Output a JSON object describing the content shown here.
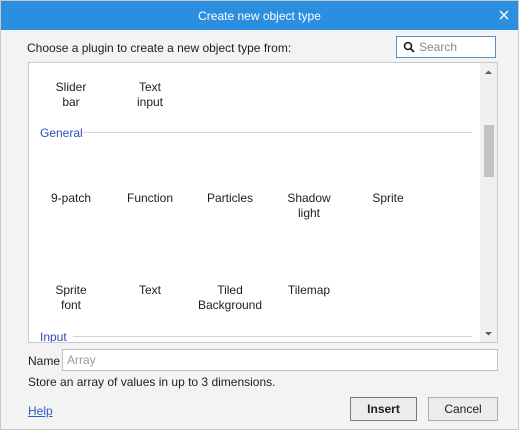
{
  "dialog": {
    "title": "Create new object type",
    "prompt": "Choose a plugin to create a new object type from:",
    "search": {
      "placeholder": "Search"
    }
  },
  "plugins": {
    "top_items": [
      {
        "line1": "Slider",
        "line2": "bar"
      },
      {
        "line1": "Text",
        "line2": "input"
      }
    ],
    "categories": {
      "general": "General",
      "input": "Input"
    },
    "general_row1": [
      {
        "line1": "9-patch",
        "line2": ""
      },
      {
        "line1": "Function",
        "line2": ""
      },
      {
        "line1": "Particles",
        "line2": ""
      },
      {
        "line1": "Shadow",
        "line2": "light"
      },
      {
        "line1": "Sprite",
        "line2": ""
      }
    ],
    "general_row2": [
      {
        "line1": "Sprite",
        "line2": "font"
      },
      {
        "line1": "Text",
        "line2": ""
      },
      {
        "line1": "Tiled",
        "line2": "Background"
      },
      {
        "line1": "Tilemap",
        "line2": ""
      }
    ]
  },
  "form": {
    "name_label": "Name",
    "name_placeholder": "Array",
    "description": "Store an array of values in up to 3 dimensions."
  },
  "footer": {
    "help": "Help",
    "insert": "Insert",
    "cancel": "Cancel"
  },
  "colors": {
    "titlebar": "#2b8ee0",
    "category": "#2a4fb8",
    "link": "#2a5fc8"
  }
}
